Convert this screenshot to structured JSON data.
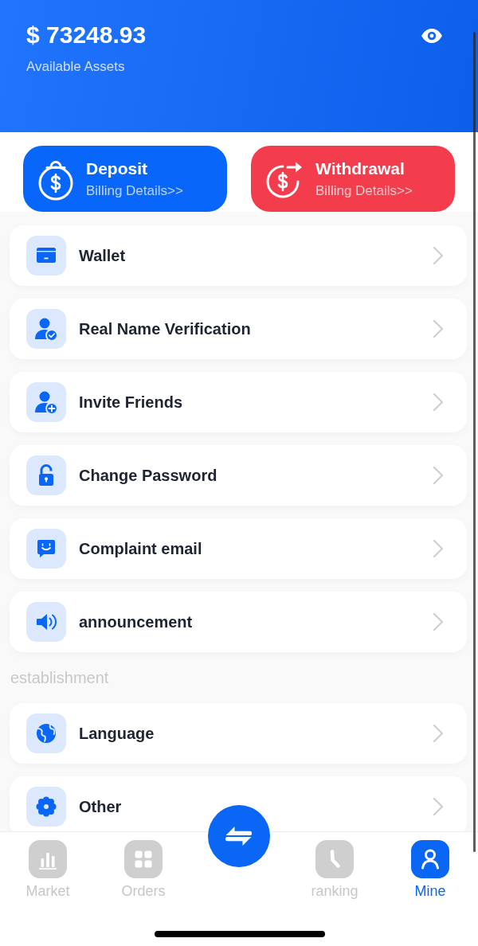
{
  "header": {
    "balance": "$ 73248.93",
    "caption": "Available Assets"
  },
  "actions": [
    {
      "kind": "deposit",
      "title": "Deposit",
      "subtitle": "Billing Details>>"
    },
    {
      "kind": "withdrawal",
      "title": "Withdrawal",
      "subtitle": "Billing Details>>"
    }
  ],
  "menu": [
    {
      "kind": "wallet",
      "label": "Wallet"
    },
    {
      "kind": "verification",
      "label": "Real Name Verification"
    },
    {
      "kind": "invite",
      "label": "Invite Friends"
    },
    {
      "kind": "password",
      "label": "Change Password"
    },
    {
      "kind": "complaint",
      "label": "Complaint email"
    },
    {
      "kind": "announcement",
      "label": "announcement"
    }
  ],
  "settings": {
    "title": "establishment",
    "items": [
      {
        "kind": "language",
        "label": "Language"
      },
      {
        "kind": "other",
        "label": "Other"
      }
    ]
  },
  "tab_bar": {
    "tabs": [
      {
        "kind": "market",
        "label": "Market",
        "selected": false
      },
      {
        "kind": "orders",
        "label": "Orders",
        "selected": false
      },
      {
        "kind": "ranking",
        "label": "ranking",
        "selected": false
      },
      {
        "kind": "mine",
        "label": "Mine",
        "selected": true
      }
    ]
  }
}
